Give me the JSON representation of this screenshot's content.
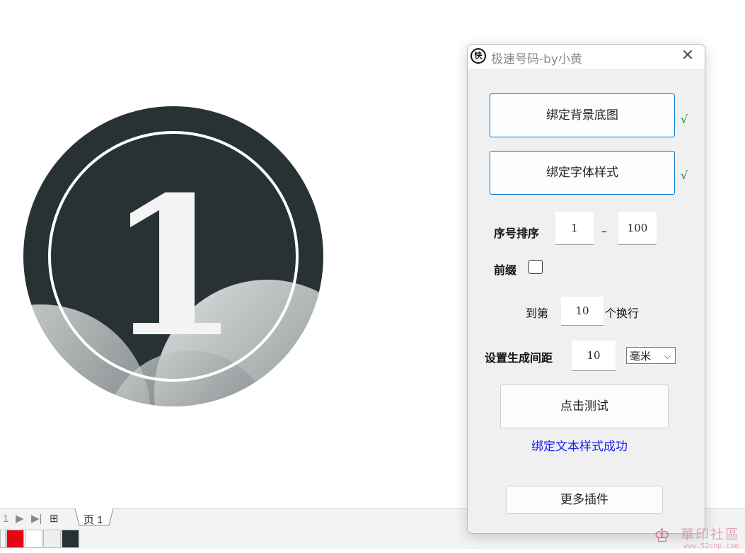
{
  "badge": {
    "numeral": "1"
  },
  "page_bar": {
    "page_number_faded": "1",
    "page_tab_label": "页 1"
  },
  "palette": {
    "swatches": [
      "#e30613",
      "#ffffff",
      "#efefef",
      "#283234"
    ]
  },
  "dialog": {
    "icon_glyph": "快",
    "title": "极速号码-by小黄",
    "close_glyph": "✕",
    "bind_background_label": "绑定背景底图",
    "bind_background_check": "√",
    "bind_font_label": "绑定字体样式",
    "bind_font_check": "√",
    "sequence_label": "序号排序",
    "sequence_start": "1",
    "sequence_dash": "–",
    "sequence_end": "100",
    "prefix_label": "前缀",
    "wrap_prefix": "到第",
    "wrap_value": "10",
    "wrap_suffix": "个换行",
    "spacing_label": "设置生成间距",
    "spacing_value": "10",
    "spacing_unit": "毫米",
    "test_button_label": "点击测试",
    "status_message": "绑定文本样式成功",
    "more_plugins_label": "更多插件"
  },
  "watermark": {
    "title": "華印社區",
    "url": "www.52cnp.com"
  },
  "colors": {
    "badge_dark": "#283234",
    "accent_blue": "#0b78d1",
    "status_blue": "#1a1aee",
    "check_green": "#1a8a1a"
  }
}
